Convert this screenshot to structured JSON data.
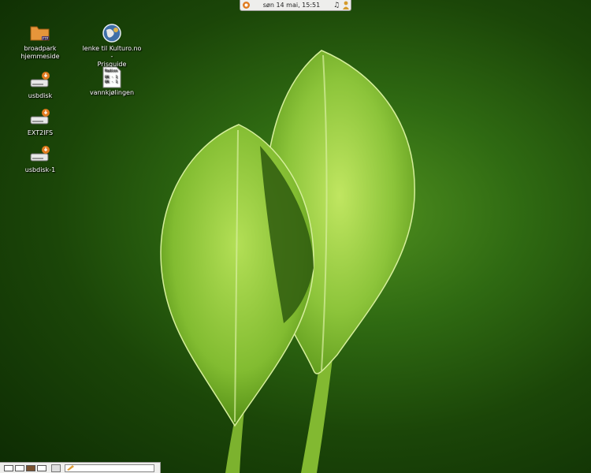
{
  "topbar": {
    "menu_icon": "ubuntu-logo-icon",
    "clock": "søn 14 mai, 15:51",
    "tray": [
      "music-note-icon",
      "user-icon"
    ]
  },
  "desktop_icons": [
    {
      "label": "broadpark\nhjemmeside",
      "icon": "ftp-folder-icon"
    },
    {
      "label": "lenke til Kulturo.no -\nPrisguide",
      "icon": "web-globe-icon"
    },
    {
      "label": "usbdisk",
      "icon": "removable-drive-icon"
    },
    {
      "label": "vannkjølingen",
      "icon": "text-document-icon"
    },
    {
      "label": "EXT2IFS",
      "icon": "removable-drive-icon"
    },
    {
      "label": "usbdisk-1",
      "icon": "removable-drive-icon"
    }
  ],
  "document_thumbnail": {
    "line1": "Radien",
    "line2": "0K - 1",
    "line3": "0K - 1"
  },
  "bottombar": {
    "workspaces": [
      "workspace-1",
      "workspace-2",
      "workspace-3",
      "workspace-4"
    ],
    "active_workspace": 3
  },
  "colors": {
    "panel": "#eeeeec",
    "leaf": "#8cc43a",
    "background": "#1b4608"
  }
}
